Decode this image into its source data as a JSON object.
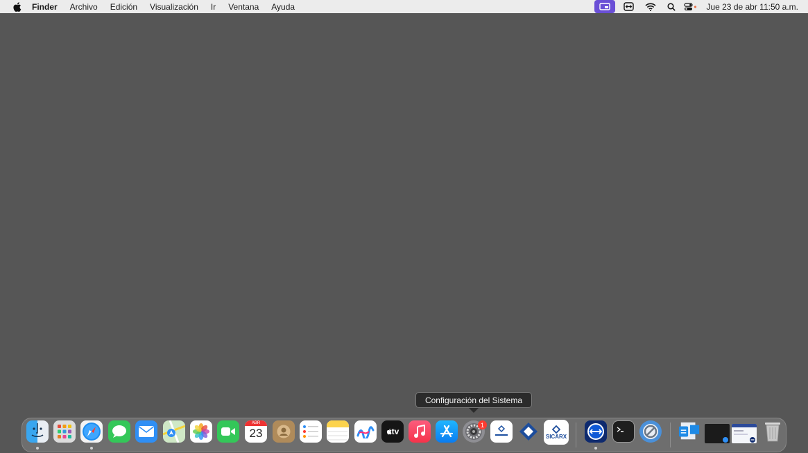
{
  "menubar": {
    "apple_icon": "apple-logo-icon",
    "items": [
      "Finder",
      "Archivo",
      "Edición",
      "Visualización",
      "Ir",
      "Ventana",
      "Ayuda"
    ],
    "status_icons": [
      "screen-sharing-icon",
      "teamviewer-icon",
      "wifi-icon",
      "search-icon",
      "control-center-icon"
    ],
    "clock": "Jue 23 de abr  11:50 a.m."
  },
  "tooltip": {
    "label": "Configuración del Sistema"
  },
  "dock": {
    "apps": [
      {
        "name": "Finder",
        "icon": "finder-icon",
        "running": true
      },
      {
        "name": "Launchpad",
        "icon": "launchpad-icon",
        "running": false
      },
      {
        "name": "Safari",
        "icon": "safari-icon",
        "running": true
      },
      {
        "name": "Mensajes",
        "icon": "messages-icon",
        "running": false
      },
      {
        "name": "Mail",
        "icon": "mail-icon",
        "running": false
      },
      {
        "name": "Mapas",
        "icon": "maps-icon",
        "running": false
      },
      {
        "name": "Fotos",
        "icon": "photos-icon",
        "running": false
      },
      {
        "name": "FaceTime",
        "icon": "facetime-icon",
        "running": false
      },
      {
        "name": "Calendario",
        "icon": "calendar-icon",
        "running": false
      },
      {
        "name": "Contactos",
        "icon": "contacts-icon",
        "running": false
      },
      {
        "name": "Recordatorios",
        "icon": "reminders-icon",
        "running": false
      },
      {
        "name": "Notas",
        "icon": "notes-icon",
        "running": false
      },
      {
        "name": "Freeform",
        "icon": "freeform-icon",
        "running": false
      },
      {
        "name": "TV",
        "icon": "apple-tv-icon",
        "running": false
      },
      {
        "name": "Música",
        "icon": "music-icon",
        "running": false
      },
      {
        "name": "App Store",
        "icon": "app-store-icon",
        "running": false
      },
      {
        "name": "Configuración del Sistema",
        "icon": "system-settings-icon",
        "running": false
      },
      {
        "name": "SICARX",
        "icon": "sicarx-small-icon",
        "running": false
      },
      {
        "name": "SICAR",
        "icon": "sicar-diamond-icon",
        "running": false
      },
      {
        "name": "SICARX",
        "icon": "sicarx-icon",
        "running": false
      },
      {
        "name": "TeamViewer",
        "icon": "teamviewer-dock-icon",
        "running": true
      },
      {
        "name": "Terminal",
        "icon": "terminal-icon",
        "running": false
      },
      {
        "name": "Network Radar",
        "icon": "blocked-app-icon",
        "running": false
      },
      {
        "name": "Downloads",
        "icon": "downloads-stack-icon",
        "running": false
      },
      {
        "name": "Window",
        "icon": "minimized-window-icon",
        "running": false
      },
      {
        "name": "Window",
        "icon": "minimized-window-icon-2",
        "running": false
      },
      {
        "name": "Papelera",
        "icon": "trash-icon",
        "running": false
      }
    ],
    "calendar": {
      "month": "ABR",
      "day": "23"
    },
    "settings_badge": "1",
    "sicarx_label": "SICARX",
    "tv_label": "tv"
  }
}
